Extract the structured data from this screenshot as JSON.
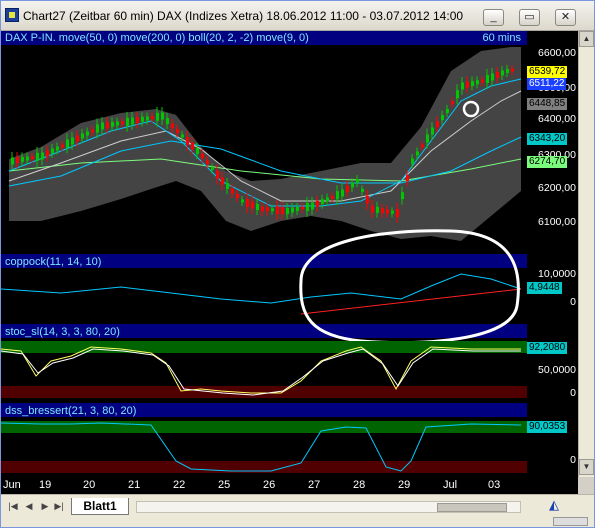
{
  "window": {
    "title": "Chart27 (Zeitbar 60 min)  DAX (Indizes Xetra) 18.06.2012 11:00 - 03.07.2012 14:00",
    "minimize_label": "_",
    "restore_label": "▭",
    "close_label": "✕"
  },
  "panels": {
    "price": {
      "label": "DAX P-IN.  move(50, 0) move(200, 0) boll(20, 2, -2) move(9, 0)",
      "timeframe": "60 mins",
      "scale_ticks": [
        "6600,00",
        "6500,00",
        "6400,00",
        "6300,00",
        "6200,00",
        "6100,00"
      ],
      "tags": [
        {
          "text": "6539,72",
          "bg": "#ffff00",
          "fg": "#000000"
        },
        {
          "text": "6511,22",
          "bg": "#1a3fff",
          "fg": "#ffffff"
        },
        {
          "text": "6448,85",
          "bg": "#808080",
          "fg": "#000000"
        },
        {
          "text": "6343,20",
          "bg": "#00c8c8",
          "fg": "#000000"
        },
        {
          "text": "6274,70",
          "bg": "#7cfc7c",
          "fg": "#000000"
        }
      ]
    },
    "coppock": {
      "label": "coppock(11, 14, 10)",
      "scale_ticks": [
        "10,0000",
        "0"
      ],
      "tag": {
        "text": "4,9448",
        "bg": "#00c8c8",
        "fg": "#000000"
      }
    },
    "stoc": {
      "label": "stoc_sl(14, 3, 3, 80, 20)",
      "scale_ticks": [
        "50,0000",
        "0"
      ],
      "tag": {
        "text": "92,2080",
        "bg": "#00c8c8",
        "fg": "#000000"
      }
    },
    "dss": {
      "label": "dss_bressert(21, 3, 80, 20)",
      "scale_ticks": [
        "0"
      ],
      "tag": {
        "text": "90,0353",
        "bg": "#00c8c8",
        "fg": "#000000"
      }
    }
  },
  "date_axis": [
    "Jun",
    "19",
    "20",
    "21",
    "22",
    "25",
    "26",
    "27",
    "28",
    "29",
    "Jul",
    "03"
  ],
  "bottom": {
    "sheet_tab": "Blatt1"
  },
  "colors": {
    "up_candle": "#00c800",
    "down_candle": "#ff0000",
    "bollinger_fill": "#505050",
    "ma_green": "#7cfc7c",
    "ma_cyan": "#00c8ff",
    "ma_white": "#cfcfcf",
    "panel_header": "#000080",
    "overbought_band": "#006400",
    "oversold_band": "#500000",
    "annotation": "#ffffff"
  }
}
